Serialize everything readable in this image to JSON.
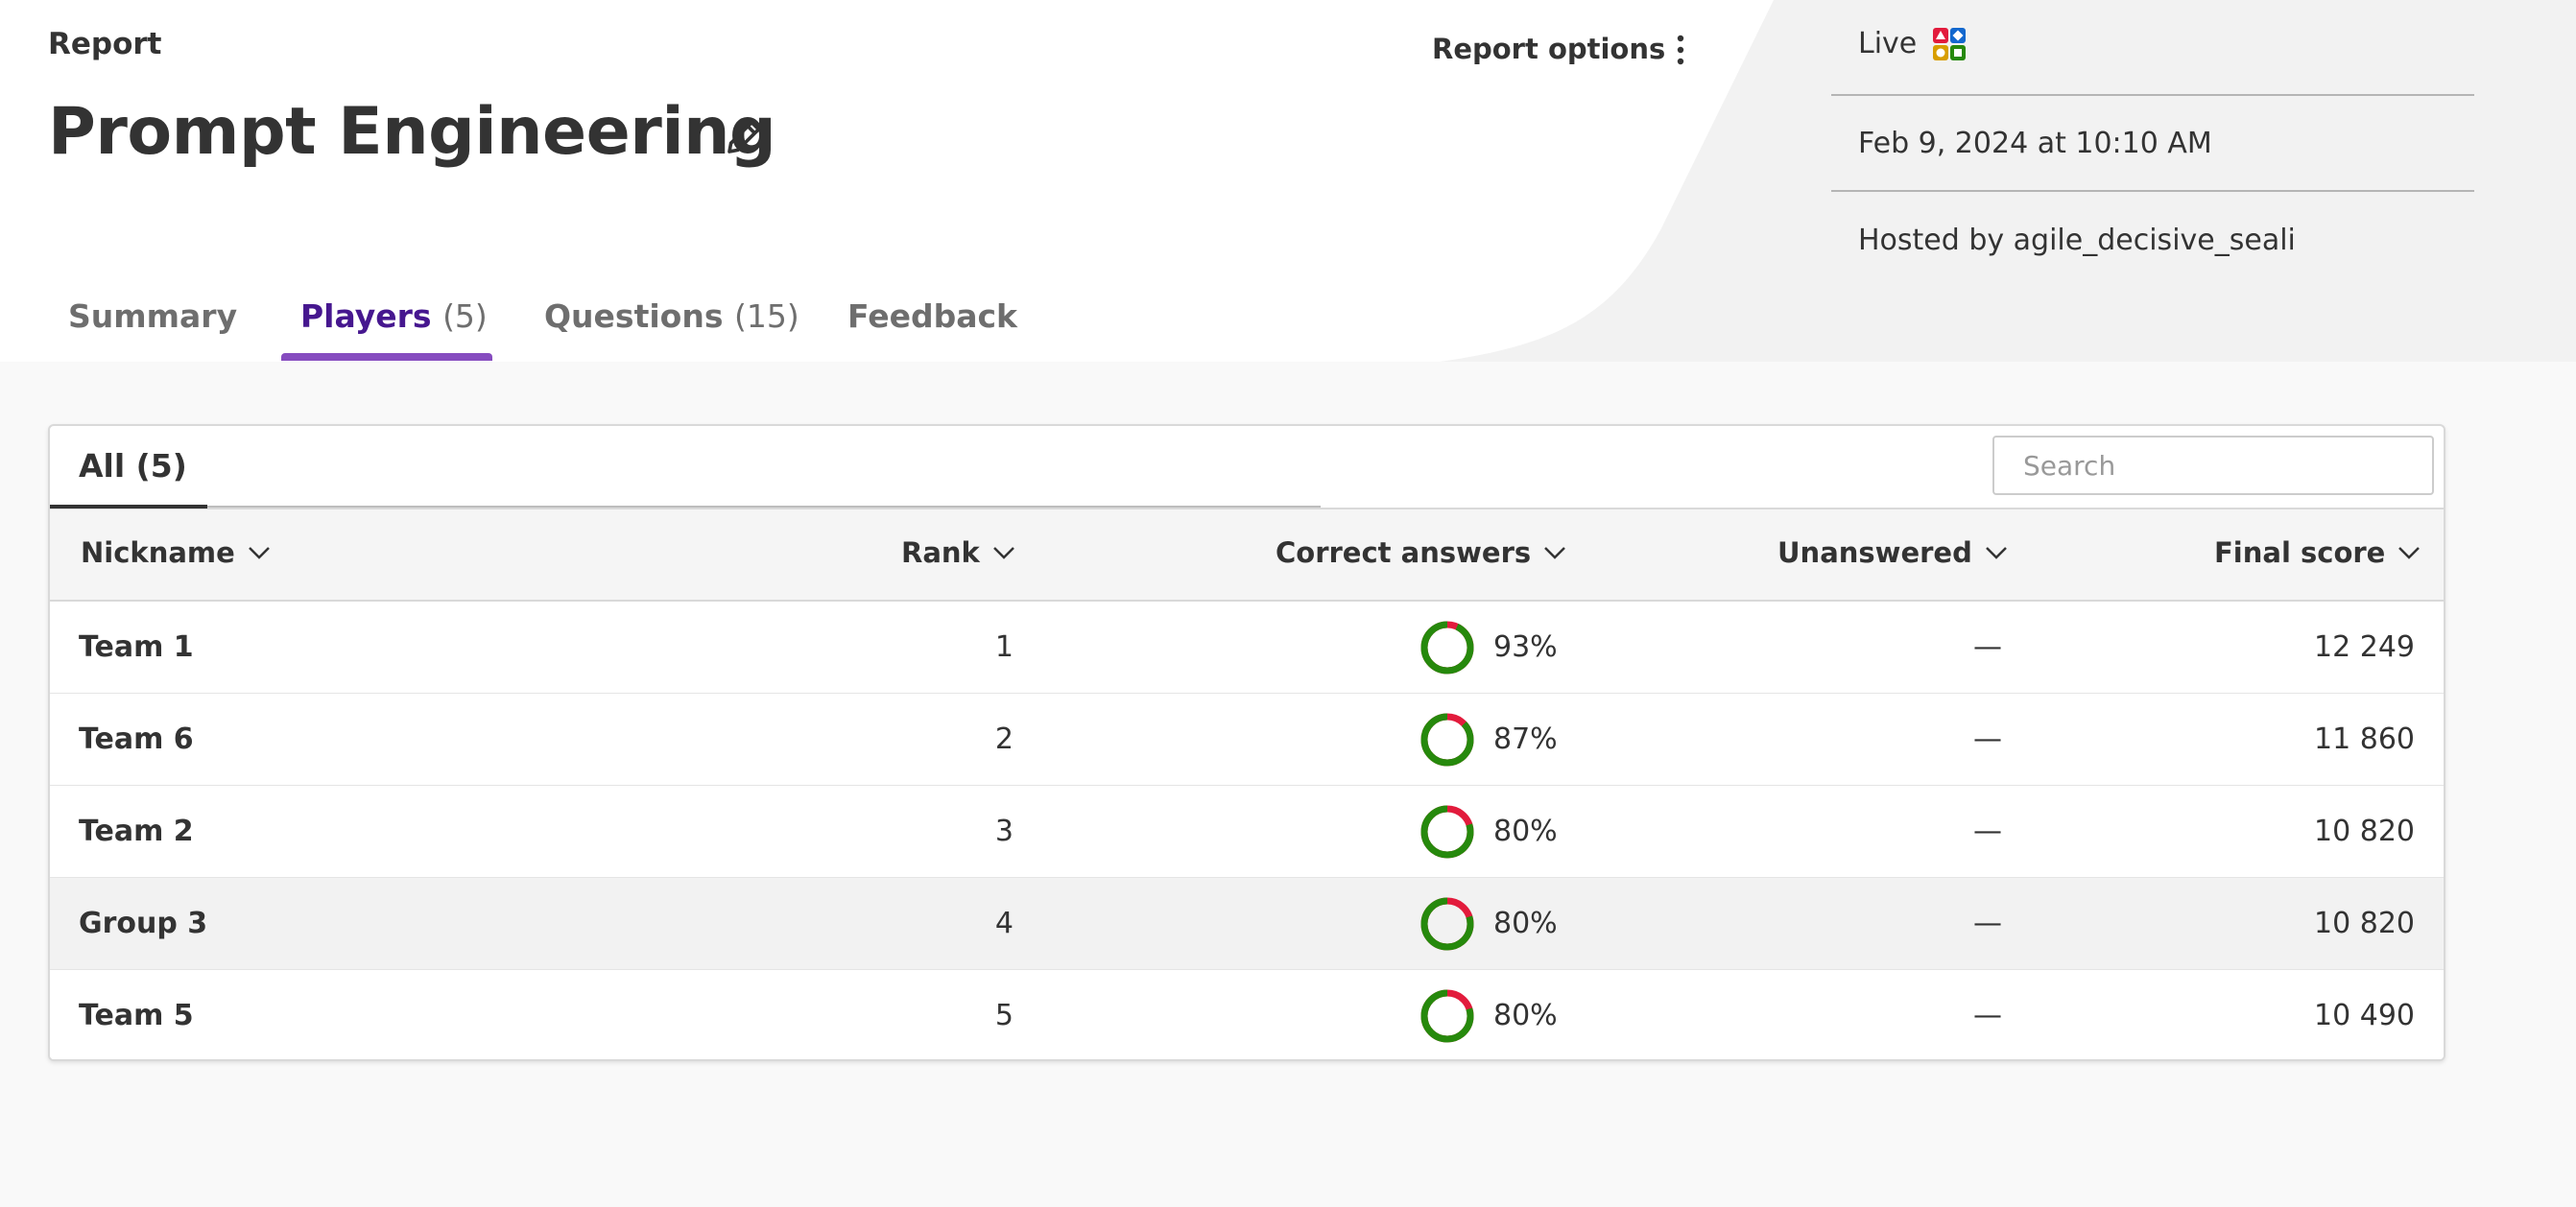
{
  "header": {
    "report_label": "Report",
    "title": "Prompt Engineering",
    "report_options_label": "Report options"
  },
  "tabs": [
    {
      "label": "Summary",
      "count": ""
    },
    {
      "label": "Players",
      "count": "(5)"
    },
    {
      "label": "Questions",
      "count": "(15)"
    },
    {
      "label": "Feedback",
      "count": ""
    }
  ],
  "meta": {
    "mode": "Live",
    "date": "Feb 9, 2024 at 10:10 AM",
    "host": "Hosted by agile_decisive_seali"
  },
  "table": {
    "filter_tab": "All (5)",
    "search_placeholder": "Search",
    "columns": [
      "Nickname",
      "Rank",
      "Correct answers",
      "Unanswered",
      "Final score"
    ],
    "rows": [
      {
        "nickname": "Team 1",
        "rank": "1",
        "correct": "93%",
        "correct_value": 0.93,
        "unanswered": "—",
        "score": "12 249"
      },
      {
        "nickname": "Team 6",
        "rank": "2",
        "correct": "87%",
        "correct_value": 0.87,
        "unanswered": "—",
        "score": "11 860"
      },
      {
        "nickname": "Team 2",
        "rank": "3",
        "correct": "80%",
        "correct_value": 0.8,
        "unanswered": "—",
        "score": "10 820"
      },
      {
        "nickname": "Group 3",
        "rank": "4",
        "correct": "80%",
        "correct_value": 0.8,
        "unanswered": "—",
        "score": "10 820"
      },
      {
        "nickname": "Team 5",
        "rank": "5",
        "correct": "80%",
        "correct_value": 0.8,
        "unanswered": "—",
        "score": "10 490"
      }
    ]
  },
  "colors": {
    "active_tab": "#46178f",
    "tab_underline": "#864cbf",
    "correct": "#26890c",
    "incorrect": "#e21b3c"
  }
}
